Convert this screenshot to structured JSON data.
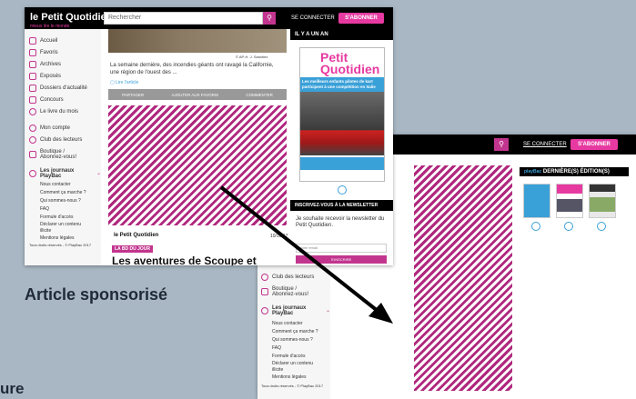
{
  "left": {
    "logo": "le Petit Quotidien",
    "logo_tagline": "mieux lire le monde",
    "search_placeholder": "Rechercher",
    "connect": "SE CONNECTER",
    "subscribe": "S'ABONNER",
    "nav": [
      "Accueil",
      "Favoris",
      "Archives",
      "Exposés",
      "Dossiers d'actualité",
      "Concours",
      "Le livre du mois"
    ],
    "nav2": [
      "Mon compte",
      "Club des lecteurs",
      "Boutique / Abonnez-vous!"
    ],
    "journals": "Les journaux PlayBac",
    "links": [
      "Nous contacter",
      "Comment ça marche ?",
      "Qui sommes-nous ?",
      "FAQ",
      "Formule d'accès",
      "Déclarer un contenu illicite",
      "Mentions légales"
    ],
    "rights": "Tous droits réservés - © PlayBac 2017",
    "photo_credit": "© AP-H. J. Sanchez",
    "article_text": "La semaine dernière, des incendies géants ont ravagé la Californie, une région de l'ouest des ...",
    "read_link": "Lire l'article",
    "actions": [
      "PARTAGER",
      "AJOUTER AUX FAVORIS",
      "COMMENTER"
    ],
    "footer_brand": "le Petit Quotidien",
    "footer_date": "10/10/17",
    "tag": "LA BD DU JOUR",
    "headline": "Les aventures de Scoupe et",
    "il_y_a_un_an": "IL Y A UN AN",
    "mag_title": "Petit Quotidien",
    "mag_headline": "Les meilleurs enfants pilotes de kart participent à une compétition en Italie",
    "newsletter": "INSCRIVEZ-VOUS À LA NEWSLETTER",
    "newsletter_text": "Je souhaite recevoir la newsletter du Petit Quotidien.",
    "email_placeholder": "Votre email",
    "subscribe_btn": "S'INSCRIRE"
  },
  "right": {
    "connect": "SE CONNECTER",
    "subscribe": "S'ABONNER",
    "editions": "DERNIÈRE(S) ÉDITION(S)",
    "playbac": "playBac",
    "nav2": [
      "Club des lecteurs",
      "Boutique / Abonnez-vous!"
    ],
    "journals": "Les journaux PlayBac",
    "links": [
      "Nous contacter",
      "Comment ça marche ?",
      "Qui sommes-nous ?",
      "FAQ",
      "Formule d'accès",
      "Déclarer un contenu illicite",
      "Mentions légales"
    ],
    "rights": "Tous droits réservés - © PlayBac 2017"
  },
  "labels": {
    "sponsored": "Article sponsorisé",
    "cut": "ure"
  },
  "colors": {
    "brand": "#c2358e",
    "pattern": "#b0287e"
  }
}
